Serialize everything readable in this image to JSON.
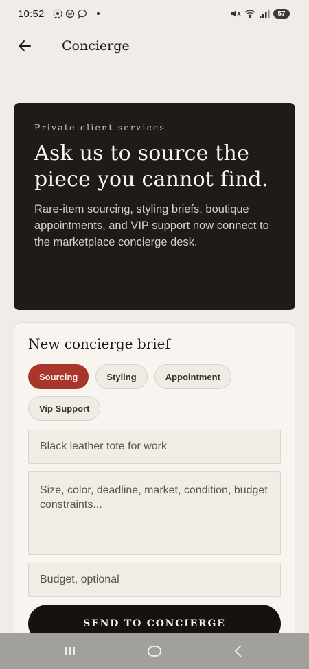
{
  "status_bar": {
    "time": "10:52",
    "battery": "57",
    "notification_icons": [
      "screenshot-icon",
      "threads-icon",
      "messenger-icon"
    ],
    "system_icons": [
      "mute-icon",
      "wifi-icon",
      "signal-icon",
      "battery-icon"
    ]
  },
  "app_bar": {
    "title": "Concierge"
  },
  "hero": {
    "kicker": "Private client services",
    "title": "Ask us to source the piece you cannot find.",
    "body": "Rare-item sourcing, styling briefs, boutique appointments, and VIP support now connect to the marketplace concierge desk."
  },
  "form": {
    "title": "New concierge brief",
    "chips": [
      {
        "label": "Sourcing",
        "selected": true
      },
      {
        "label": "Styling",
        "selected": false
      },
      {
        "label": "Appointment",
        "selected": false
      },
      {
        "label": "Vip Support",
        "selected": false
      }
    ],
    "item_placeholder": "Black leather tote for work",
    "details_placeholder": "Size, color, deadline, market, condition, budget constraints...",
    "budget_placeholder": "Budget, optional",
    "submit_label": "SEND TO CONCIERGE"
  },
  "colors": {
    "accent": "#a8362a",
    "hero_bg": "#1f1b19",
    "page_bg": "#f0ede8",
    "button_bg": "#16120f"
  }
}
